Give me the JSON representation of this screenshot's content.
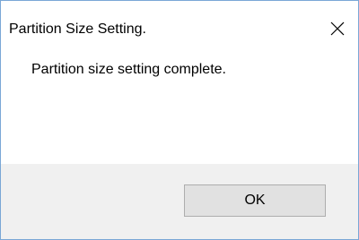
{
  "dialog": {
    "title": "Partition Size Setting.",
    "message": "Partition size setting complete.",
    "ok_label": "OK",
    "close_icon": "close-icon"
  },
  "colors": {
    "window_border": "#7aa7d6",
    "footer_bg": "#f0f0f0",
    "button_bg": "#e1e1e1",
    "button_border": "#adadad"
  }
}
